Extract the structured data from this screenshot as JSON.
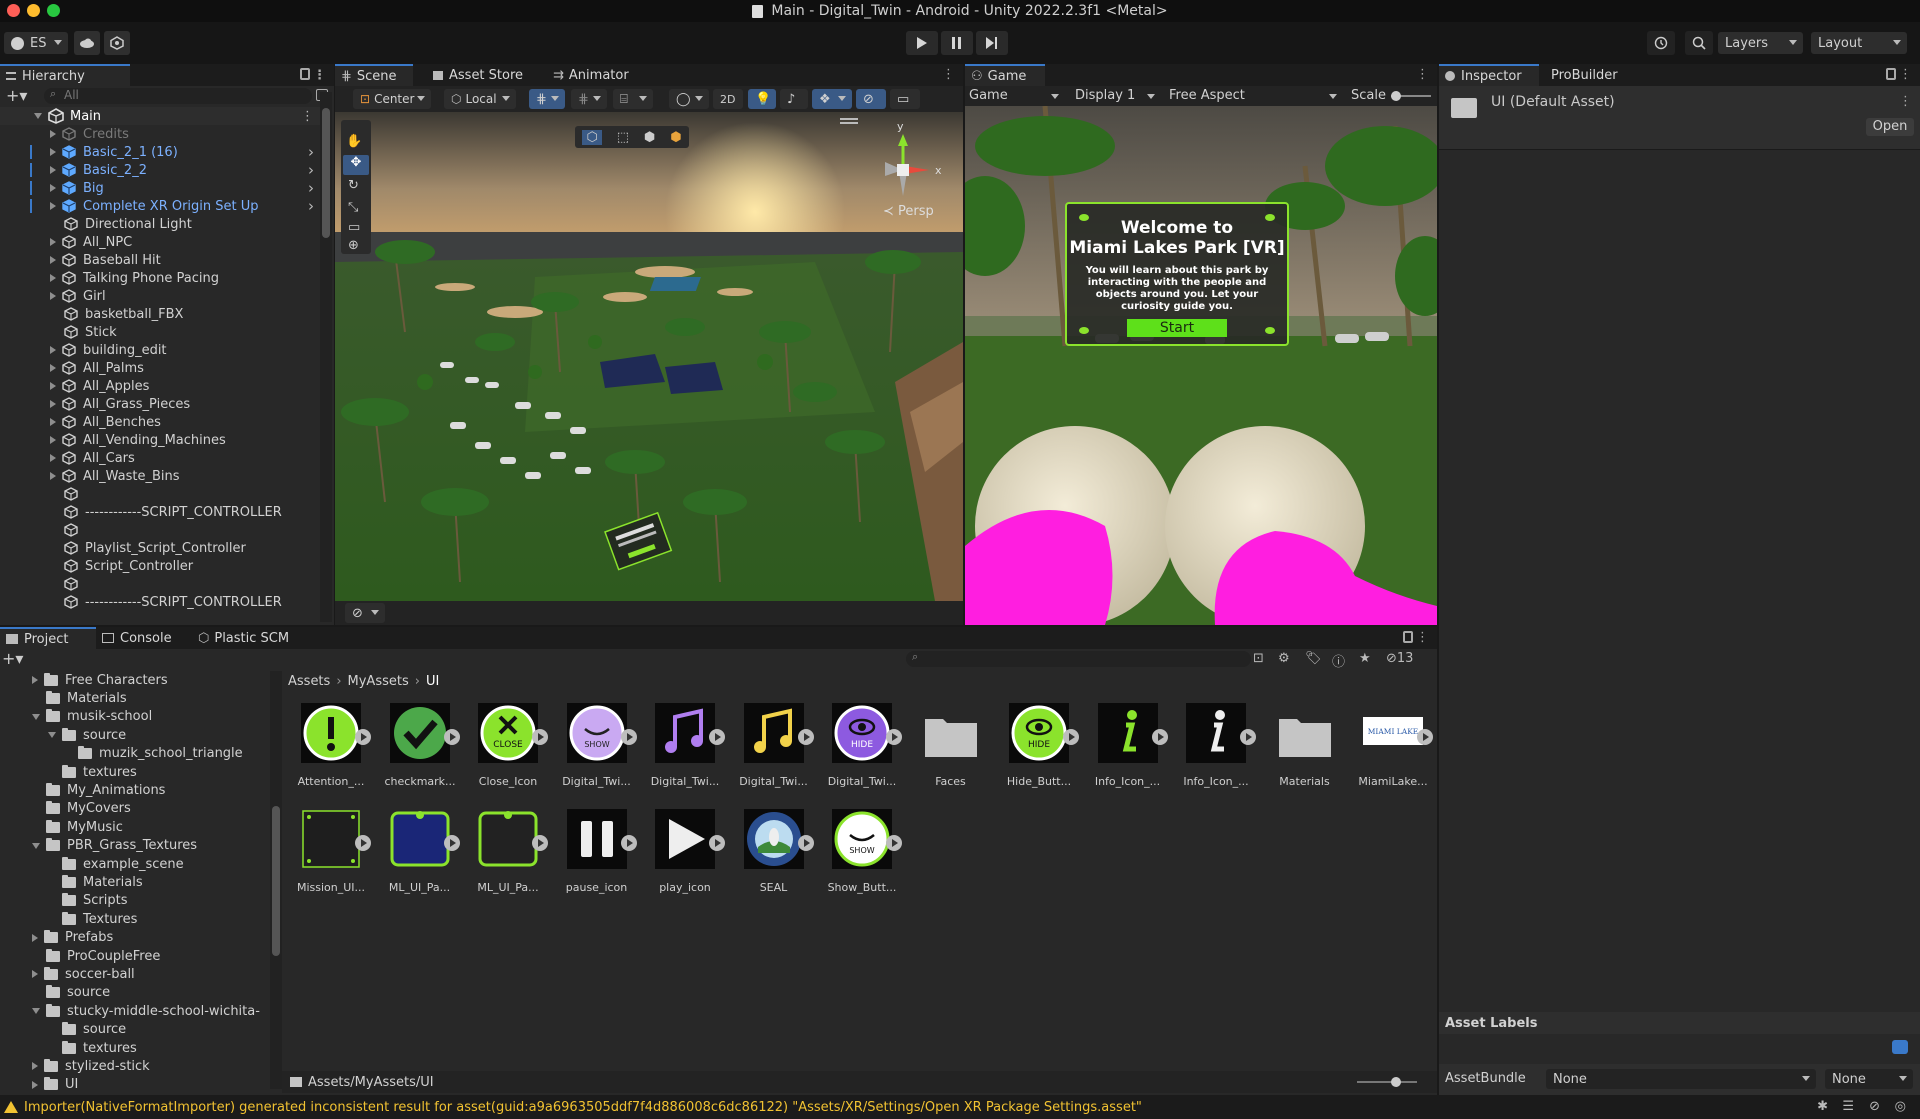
{
  "window": {
    "title": "Main - Digital_Twin - Android - Unity 2022.2.3f1 <Metal>"
  },
  "toolbar": {
    "account": "ES",
    "layers": "Layers",
    "layout": "Layout"
  },
  "hierarchy": {
    "tab": "Hierarchy",
    "search_placeholder": "All",
    "root": "Main",
    "items": [
      {
        "label": "Credits",
        "style": "grey",
        "arrow": true,
        "prefab": false
      },
      {
        "label": "Basic_2_1 (16)",
        "style": "blue",
        "arrow": true,
        "prefab": true
      },
      {
        "label": "Basic_2_2",
        "style": "blue",
        "arrow": true,
        "prefab": true
      },
      {
        "label": "Big",
        "style": "blue",
        "arrow": true,
        "prefab": true
      },
      {
        "label": "Complete XR Origin Set Up",
        "style": "blue",
        "arrow": true,
        "prefab": true
      },
      {
        "label": "Directional Light",
        "style": "",
        "arrow": false,
        "prefab": false
      },
      {
        "label": "All_NPC",
        "style": "",
        "arrow": true,
        "prefab": false
      },
      {
        "label": "Baseball Hit",
        "style": "",
        "arrow": true,
        "prefab": false
      },
      {
        "label": "Talking Phone Pacing",
        "style": "",
        "arrow": true,
        "prefab": false
      },
      {
        "label": "Girl",
        "style": "",
        "arrow": true,
        "prefab": false
      },
      {
        "label": "basketball_FBX",
        "style": "",
        "arrow": false,
        "prefab": false
      },
      {
        "label": "Stick",
        "style": "",
        "arrow": false,
        "prefab": false
      },
      {
        "label": "building_edit",
        "style": "",
        "arrow": true,
        "prefab": false
      },
      {
        "label": "All_Palms",
        "style": "",
        "arrow": true,
        "prefab": false
      },
      {
        "label": "All_Apples",
        "style": "",
        "arrow": true,
        "prefab": false
      },
      {
        "label": "All_Grass_Pieces",
        "style": "",
        "arrow": true,
        "prefab": false
      },
      {
        "label": "All_Benches",
        "style": "",
        "arrow": true,
        "prefab": false
      },
      {
        "label": "All_Vending_Machines",
        "style": "",
        "arrow": true,
        "prefab": false
      },
      {
        "label": "All_Cars",
        "style": "",
        "arrow": true,
        "prefab": false
      },
      {
        "label": "All_Waste_Bins",
        "style": "",
        "arrow": true,
        "prefab": false
      },
      {
        "label": "",
        "style": "",
        "arrow": false,
        "prefab": false
      },
      {
        "label": "------------SCRIPT_CONTROLLER",
        "style": "",
        "arrow": false,
        "prefab": false
      },
      {
        "label": "",
        "style": "",
        "arrow": false,
        "prefab": false
      },
      {
        "label": "Playlist_Script_Controller",
        "style": "",
        "arrow": false,
        "prefab": false
      },
      {
        "label": "Script_Controller",
        "style": "",
        "arrow": false,
        "prefab": false
      },
      {
        "label": "",
        "style": "",
        "arrow": false,
        "prefab": false
      },
      {
        "label": "------------SCRIPT_CONTROLLER",
        "style": "",
        "arrow": false,
        "prefab": false
      }
    ]
  },
  "scene": {
    "tabs": [
      "Scene",
      "Asset Store",
      "Animator"
    ],
    "pivot": "Center",
    "space": "Local",
    "mode2d": "2D",
    "persp": "Persp",
    "axis_x": "x",
    "axis_y": "y"
  },
  "game": {
    "tab": "Game",
    "view": "Game",
    "display": "Display 1",
    "aspect": "Free Aspect",
    "scale": "Scale",
    "welcome_title": "Welcome to",
    "park_name": "Miami Lakes Park [VR]",
    "body": "You will learn about this park by interacting with the people and objects around you. Let your curiosity guide you.",
    "start": "Start"
  },
  "inspector": {
    "tabs": [
      "Inspector",
      "ProBuilder"
    ],
    "title": "UI (Default Asset)",
    "open": "Open",
    "asset_labels": "Asset Labels",
    "assetbundle": "AssetBundle",
    "bundle1": "None",
    "bundle2": "None"
  },
  "project": {
    "tabs": [
      "Project",
      "Console",
      "Plastic SCM"
    ],
    "tree": [
      {
        "label": "Free Characters",
        "indent": 0,
        "arrow": "right"
      },
      {
        "label": "Materials",
        "indent": 0,
        "arrow": "none"
      },
      {
        "label": "musik-school",
        "indent": 0,
        "arrow": "down"
      },
      {
        "label": "source",
        "indent": 1,
        "arrow": "down"
      },
      {
        "label": "muzik_school_triangle",
        "indent": 2,
        "arrow": "none"
      },
      {
        "label": "textures",
        "indent": 1,
        "arrow": "none"
      },
      {
        "label": "My_Animations",
        "indent": 0,
        "arrow": "none"
      },
      {
        "label": "MyCovers",
        "indent": 0,
        "arrow": "none"
      },
      {
        "label": "MyMusic",
        "indent": 0,
        "arrow": "none"
      },
      {
        "label": "PBR_Grass_Textures",
        "indent": 0,
        "arrow": "down"
      },
      {
        "label": "example_scene",
        "indent": 1,
        "arrow": "none"
      },
      {
        "label": "Materials",
        "indent": 1,
        "arrow": "none"
      },
      {
        "label": "Scripts",
        "indent": 1,
        "arrow": "none"
      },
      {
        "label": "Textures",
        "indent": 1,
        "arrow": "none"
      },
      {
        "label": "Prefabs",
        "indent": 0,
        "arrow": "right"
      },
      {
        "label": "ProCoupleFree",
        "indent": 0,
        "arrow": "none"
      },
      {
        "label": "soccer-ball",
        "indent": 0,
        "arrow": "right"
      },
      {
        "label": "source",
        "indent": 0,
        "arrow": "none"
      },
      {
        "label": "stucky-middle-school-wichita-",
        "indent": 0,
        "arrow": "down"
      },
      {
        "label": "source",
        "indent": 1,
        "arrow": "none"
      },
      {
        "label": "textures",
        "indent": 1,
        "arrow": "none"
      },
      {
        "label": "stylized-stick",
        "indent": 0,
        "arrow": "right"
      },
      {
        "label": "UI",
        "indent": 0,
        "arrow": "right"
      }
    ],
    "breadcrumb": [
      "Assets",
      "MyAssets",
      "UI"
    ],
    "hidden_count": "13",
    "assets_row1": [
      {
        "label": "Attention_...",
        "kind": "attention"
      },
      {
        "label": "checkmark...",
        "kind": "check"
      },
      {
        "label": "Close_Icon",
        "kind": "close"
      },
      {
        "label": "Digital_Twi...",
        "kind": "show-purple"
      },
      {
        "label": "Digital_Twi...",
        "kind": "note-purple"
      },
      {
        "label": "Digital_Twi...",
        "kind": "note-yellow"
      },
      {
        "label": "Digital_Twi...",
        "kind": "hide-purple"
      },
      {
        "label": "Faces",
        "kind": "folder"
      },
      {
        "label": "Hide_Butt...",
        "kind": "hide-green"
      },
      {
        "label": "Info_Icon_...",
        "kind": "info-green"
      },
      {
        "label": "Info_Icon_...",
        "kind": "info-white"
      },
      {
        "label": "Materials",
        "kind": "folder"
      },
      {
        "label": "MiamiLake...",
        "kind": "logo"
      }
    ],
    "assets_row2": [
      {
        "label": "Mission_UI...",
        "kind": "panel-dark"
      },
      {
        "label": "ML_UI_Pa...",
        "kind": "panel-blue"
      },
      {
        "label": "ML_UI_Pa...",
        "kind": "panel-dark2"
      },
      {
        "label": "pause_icon",
        "kind": "pause"
      },
      {
        "label": "play_icon",
        "kind": "play"
      },
      {
        "label": "SEAL",
        "kind": "seal"
      },
      {
        "label": "Show_Butt...",
        "kind": "show-green"
      }
    ],
    "status_path": "Assets/MyAssets/UI",
    "close_text": "CLOSE",
    "show_text": "SHOW",
    "hide_text": "HIDE",
    "logo_text": "MIAMI LAKE"
  },
  "console": {
    "message": "Importer(NativeFormatImporter) generated inconsistent result for asset(guid:a9a6963505ddf7f4d886008c6dc86122) \"Assets/XR/Settings/Open XR Package Settings.asset\""
  },
  "colors": {
    "accent": "#3a79c9",
    "lime": "#8be32c",
    "magenta": "#ff1ee0",
    "prefab": "#7cb1ff"
  }
}
